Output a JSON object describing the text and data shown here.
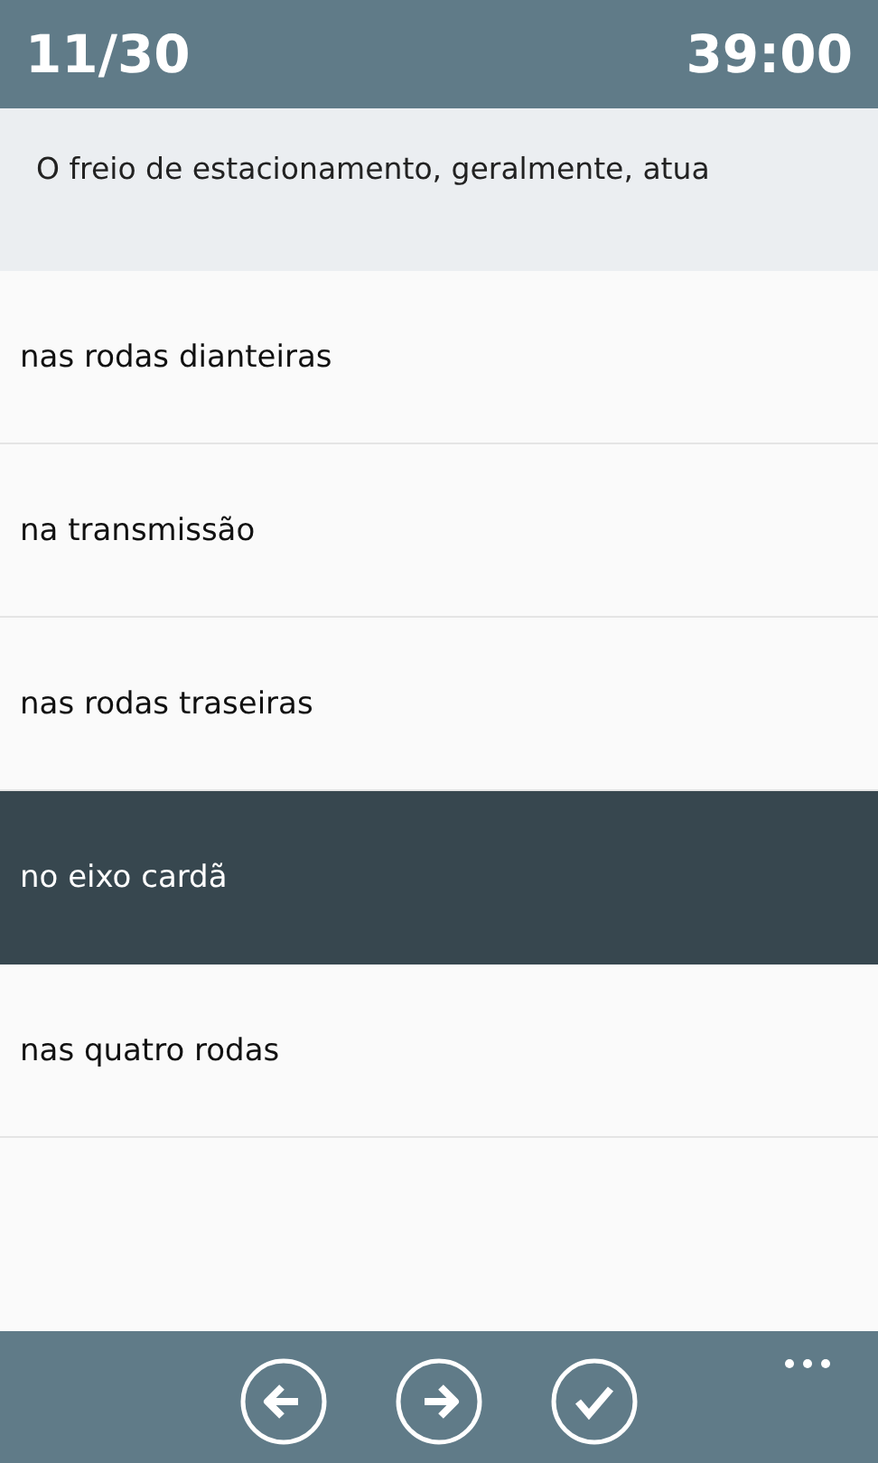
{
  "header": {
    "counter": "11/30",
    "timer": "39:00"
  },
  "question": "O freio de estacionamento, geralmente, atua",
  "options": [
    {
      "label": "nas rodas dianteiras",
      "selected": false
    },
    {
      "label": "na transmissão",
      "selected": false
    },
    {
      "label": "nas rodas traseiras",
      "selected": false
    },
    {
      "label": "no eixo cardã",
      "selected": true
    },
    {
      "label": "nas quatro rodas",
      "selected": false
    }
  ],
  "app_bar": {
    "buttons": [
      {
        "kind": "back"
      },
      {
        "kind": "forward"
      },
      {
        "kind": "check"
      }
    ]
  }
}
